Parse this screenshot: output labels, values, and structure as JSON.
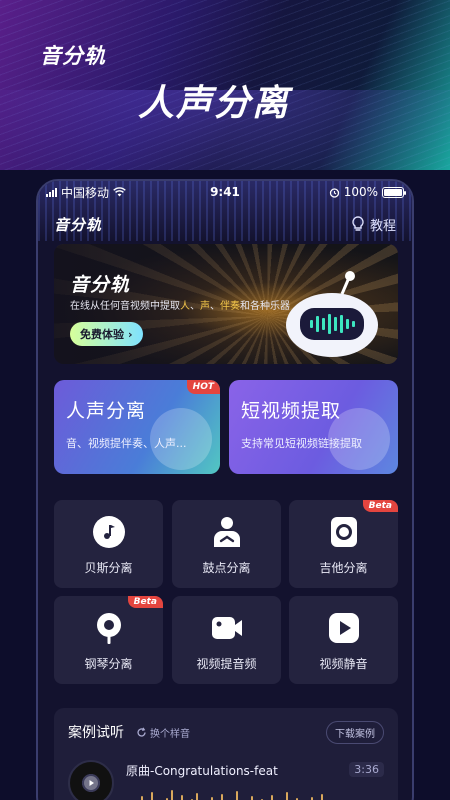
{
  "promo": {
    "brand": "音分轨",
    "title": "人声分离"
  },
  "status_bar": {
    "carrier": "中国移动",
    "time": "9:41",
    "battery": "100%"
  },
  "app": {
    "name": "音分轨",
    "tutorial_label": "教程"
  },
  "banner": {
    "title": "音分轨",
    "subtitle_prefix": "在线从任何音视频中提取",
    "subtitle_vocal": "人",
    "sep1": "、",
    "subtitle_voice": "声",
    "sep2": "、",
    "subtitle_accomp": "伴奏",
    "subtitle_suffix": "和各种乐器",
    "button_label": "免费体验",
    "button_chevron": "›"
  },
  "cards": {
    "vocal": {
      "title": "人声分离",
      "desc": "音、视频提伴奏、人声...",
      "badge": "HOT"
    },
    "video": {
      "title": "短视频提取",
      "desc": "支持常见短视频链接提取"
    }
  },
  "tools": [
    {
      "label": "贝斯分离",
      "icon": "music-note-icon",
      "badge": ""
    },
    {
      "label": "鼓点分离",
      "icon": "drummer-icon",
      "badge": ""
    },
    {
      "label": "吉他分离",
      "icon": "speaker-icon",
      "badge": "Beta"
    },
    {
      "label": "钢琴分离",
      "icon": "pin-icon",
      "badge": "Beta"
    },
    {
      "label": "视频提音频",
      "icon": "video-camera-icon",
      "badge": ""
    },
    {
      "label": "视频静音",
      "icon": "play-icon",
      "badge": ""
    }
  ],
  "cases": {
    "title": "案例试听",
    "swap_label": "换个样音",
    "download_label": "下载案例",
    "track_name": "原曲-Congratulations-feat",
    "track_time": "3:36"
  },
  "colors": {
    "accent_red": "#e4453f",
    "highlight_yellow": "#f3c64a",
    "button_gradient_start": "#d7ff9a",
    "button_gradient_end": "#7fe2ff"
  }
}
